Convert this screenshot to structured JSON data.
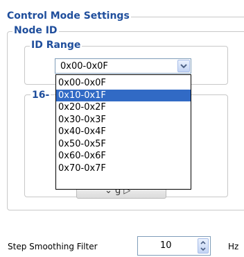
{
  "control_mode": {
    "title": "Control Mode Settings"
  },
  "node_id": {
    "title": "Node ID"
  },
  "id_range": {
    "title": "ID Range",
    "selected_value": "0x00-0x0F",
    "options": [
      "0x00-0x0F",
      "0x10-0x1F",
      "0x20-0x2F",
      "0x30-0x3F",
      "0x40-0x4F",
      "0x50-0x5F",
      "0x60-0x6F",
      "0x70-0x7F"
    ],
    "highlighted_option": "0x10-0x1F"
  },
  "group_16": {
    "title_partial": "16-"
  },
  "step_smoothing": {
    "label": "Step Smoothing Filter",
    "value": "10",
    "unit": "Hz"
  },
  "icons": {
    "dropdown_arrow": "chevron-down-icon",
    "spin_up": "chevron-up-icon",
    "spin_down": "chevron-down-icon"
  },
  "colors": {
    "group_title": "#1f4e9c",
    "selection_bg": "#316ac5",
    "selection_fg": "#ffffff"
  }
}
